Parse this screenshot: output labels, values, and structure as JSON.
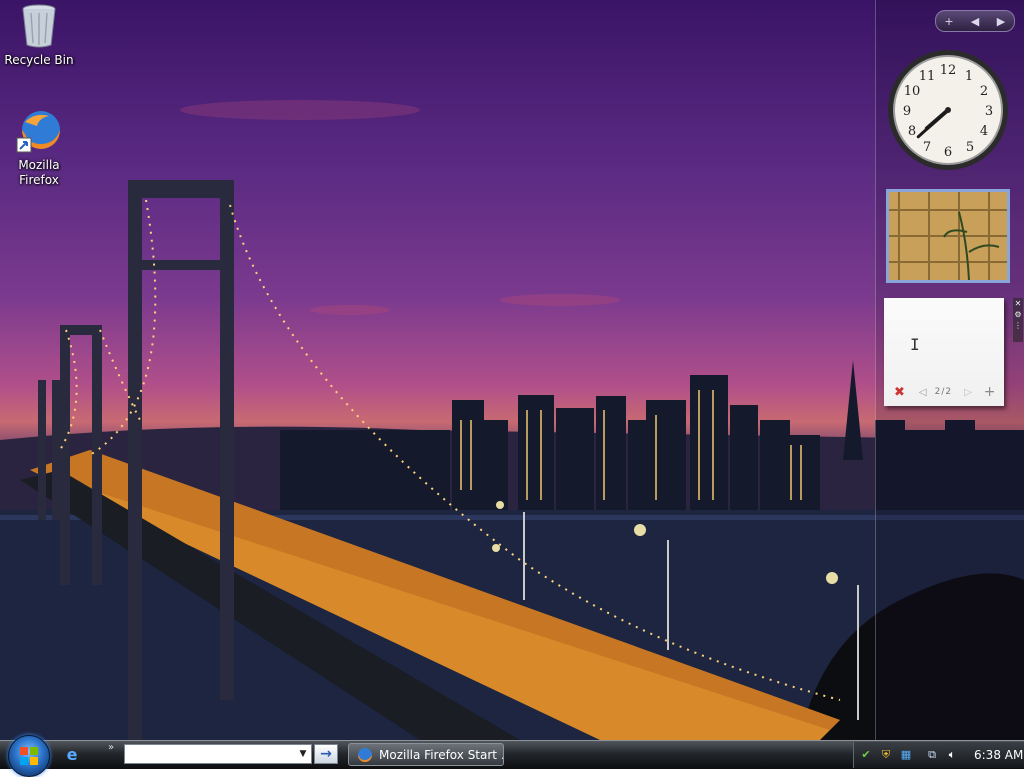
{
  "desktop": {
    "icons": [
      {
        "label": "Recycle Bin",
        "icon": "recycle-bin-icon"
      },
      {
        "label": "Mozilla Firefox",
        "icon": "firefox-icon"
      }
    ]
  },
  "sidebar": {
    "controls": {
      "add": "+",
      "prev": "◀",
      "next": "▶"
    },
    "notes": {
      "page": "2/2",
      "delete": "✖",
      "add": "+",
      "prev": "◁",
      "next": "▷",
      "cursor": "I"
    },
    "clock": {
      "hour": 7,
      "minute": 38
    }
  },
  "taskbar": {
    "quicklaunch_more": "»",
    "address_dropdown": "▼",
    "go": "→",
    "tasks": [
      {
        "label": "Mozilla Firefox Start ...",
        "icon": "firefox-icon"
      }
    ],
    "tray": {
      "time": "6:38 AM"
    }
  },
  "colors": {
    "sky_top": "#3a1466",
    "sky_horizon": "#c86a72",
    "bridge_lights": "#ffb23a",
    "taskbar": "#23272c"
  }
}
